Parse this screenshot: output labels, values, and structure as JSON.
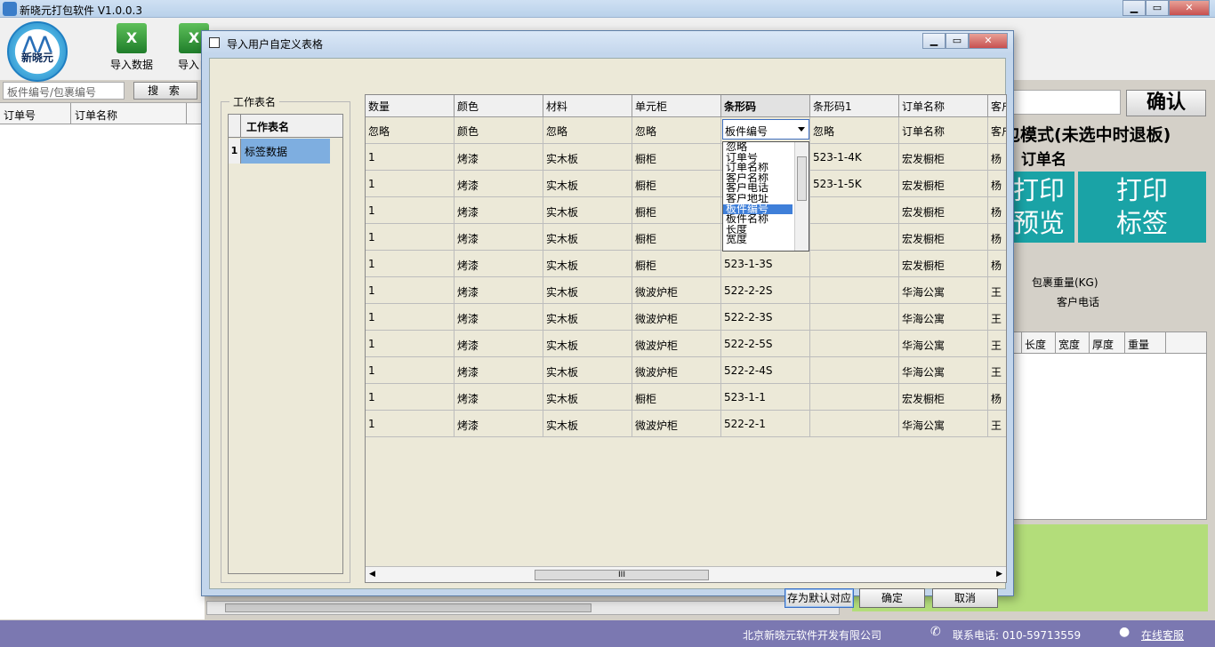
{
  "app": {
    "title": "新晓元打包软件 V1.0.0.3",
    "logo_text": "新晓元",
    "window_controls": {
      "minimize": "▁",
      "maximize": "▭",
      "close": "✕"
    }
  },
  "toolbar": {
    "import_data": "导入数据",
    "import_custom": "导入自"
  },
  "left_panel": {
    "search_placeholder": "板件编号/包裹编号",
    "search_button": "搜 索",
    "columns": [
      "订单号",
      "订单名称"
    ]
  },
  "right_panel": {
    "confirm_button": "确认",
    "mode_text": "包模式(未选中时退板)",
    "order_name": "订单名",
    "print_preview": "打印\n预览",
    "print_label": "打印\n标签",
    "package_weight": "包裹重量(KG)",
    "customer_phone": "客户电话",
    "grid_columns": [
      "长度",
      "宽度",
      "厚度",
      "重量"
    ]
  },
  "status_bar": {
    "company": "北京新晓元软件开发有限公司",
    "phone": "联系电话: 010-59713559",
    "online_service": "在线客服"
  },
  "dialog": {
    "title": "导入用户自定义表格",
    "sheet_group_label": "工作表名",
    "sheet_list_header": "工作表名",
    "sheets": [
      {
        "index": "1",
        "name": "标签数据"
      }
    ],
    "columns": [
      "数量",
      "颜色",
      "材料",
      "单元柜",
      "条形码",
      "条形码1",
      "订单名称",
      "客户"
    ],
    "mapping_row": [
      "忽略",
      "颜色",
      "忽略",
      "忽略",
      "板件编号",
      "忽略",
      "订单名称",
      "客户"
    ],
    "selected_column": "条形码",
    "rows": [
      [
        "1",
        "烤漆",
        "实木板",
        "橱柜",
        "",
        "523-1-4K",
        "宏发橱柜",
        "杨"
      ],
      [
        "1",
        "烤漆",
        "实木板",
        "橱柜",
        "",
        "523-1-5K",
        "宏发橱柜",
        "杨"
      ],
      [
        "1",
        "烤漆",
        "实木板",
        "橱柜",
        "",
        "",
        "宏发橱柜",
        "杨"
      ],
      [
        "1",
        "烤漆",
        "实木板",
        "橱柜",
        "",
        "",
        "宏发橱柜",
        "杨"
      ],
      [
        "1",
        "烤漆",
        "实木板",
        "橱柜",
        "523-1-3S",
        "",
        "宏发橱柜",
        "杨"
      ],
      [
        "1",
        "烤漆",
        "实木板",
        "微波炉柜",
        "522-2-2S",
        "",
        "华海公寓",
        "王"
      ],
      [
        "1",
        "烤漆",
        "实木板",
        "微波炉柜",
        "522-2-3S",
        "",
        "华海公寓",
        "王"
      ],
      [
        "1",
        "烤漆",
        "实木板",
        "微波炉柜",
        "522-2-5S",
        "",
        "华海公寓",
        "王"
      ],
      [
        "1",
        "烤漆",
        "实木板",
        "微波炉柜",
        "522-2-4S",
        "",
        "华海公寓",
        "王"
      ],
      [
        "1",
        "烤漆",
        "实木板",
        "橱柜",
        "523-1-1",
        "",
        "宏发橱柜",
        "杨"
      ],
      [
        "1",
        "烤漆",
        "实木板",
        "微波炉柜",
        "522-2-1",
        "",
        "华海公寓",
        "王"
      ]
    ],
    "dropdown": {
      "value": "板件编号",
      "options": [
        "忽略",
        "订单号",
        "订单名称",
        "客户名称",
        "客户电话",
        "客户地址",
        "板件编号",
        "板件名称",
        "长度",
        "宽度"
      ],
      "highlighted": "板件编号"
    },
    "buttons": {
      "save_default": "存为默认对应",
      "ok": "确定",
      "cancel": "取消"
    },
    "scroll_thumb_label": "III"
  },
  "colors": {
    "print_button": "#1aa3a6",
    "green_panel": "#b3dd7a",
    "status_bar": "#7b78b1",
    "selection": "#7eaee0",
    "dropdown_highlight": "#3f7fd9"
  }
}
